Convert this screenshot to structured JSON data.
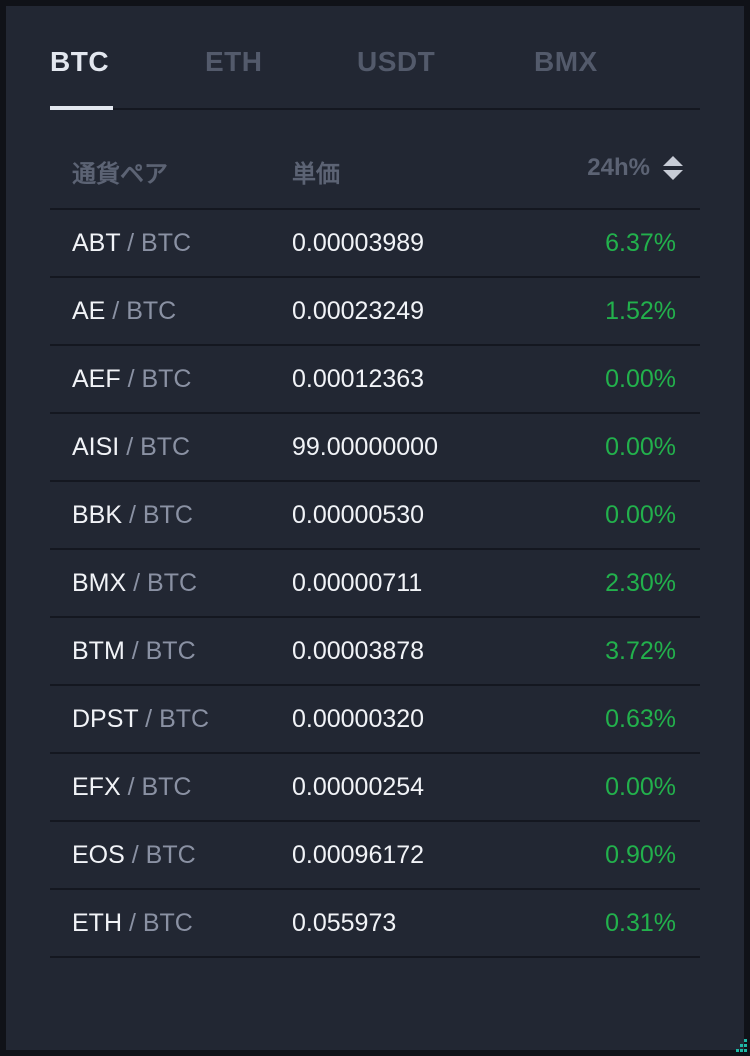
{
  "tabs": [
    {
      "label": "BTC",
      "active": true
    },
    {
      "label": "ETH",
      "active": false
    },
    {
      "label": "USDT",
      "active": false
    },
    {
      "label": "BMX",
      "active": false
    }
  ],
  "header": {
    "pair": "通貨ペア",
    "price": "単価",
    "change": "24h%"
  },
  "colors": {
    "background": "#222733",
    "positive": "#22b14c",
    "accent": "#1fb8a6"
  },
  "icons": {
    "sort": "sort-updown-icon",
    "corner": "corner-dots-icon"
  },
  "rows": [
    {
      "base": "ABT",
      "sep": " / ",
      "quote": "BTC",
      "price": "0.00003989",
      "change": "6.37%"
    },
    {
      "base": "AE",
      "sep": " / ",
      "quote": "BTC",
      "price": "0.00023249",
      "change": "1.52%"
    },
    {
      "base": "AEF",
      "sep": " / ",
      "quote": "BTC",
      "price": "0.00012363",
      "change": "0.00%"
    },
    {
      "base": "AISI",
      "sep": " / ",
      "quote": "BTC",
      "price": "99.00000000",
      "change": "0.00%"
    },
    {
      "base": "BBK",
      "sep": " / ",
      "quote": "BTC",
      "price": "0.00000530",
      "change": "0.00%"
    },
    {
      "base": "BMX",
      "sep": " / ",
      "quote": "BTC",
      "price": "0.00000711",
      "change": "2.30%"
    },
    {
      "base": "BTM",
      "sep": " / ",
      "quote": "BTC",
      "price": "0.00003878",
      "change": "3.72%"
    },
    {
      "base": "DPST",
      "sep": " / ",
      "quote": "BTC",
      "price": "0.00000320",
      "change": "0.63%"
    },
    {
      "base": "EFX",
      "sep": " / ",
      "quote": "BTC",
      "price": "0.00000254",
      "change": "0.00%"
    },
    {
      "base": "EOS",
      "sep": " / ",
      "quote": "BTC",
      "price": "0.00096172",
      "change": "0.90%"
    },
    {
      "base": "ETH",
      "sep": " / ",
      "quote": "BTC",
      "price": "0.055973",
      "change": "0.31%"
    }
  ]
}
